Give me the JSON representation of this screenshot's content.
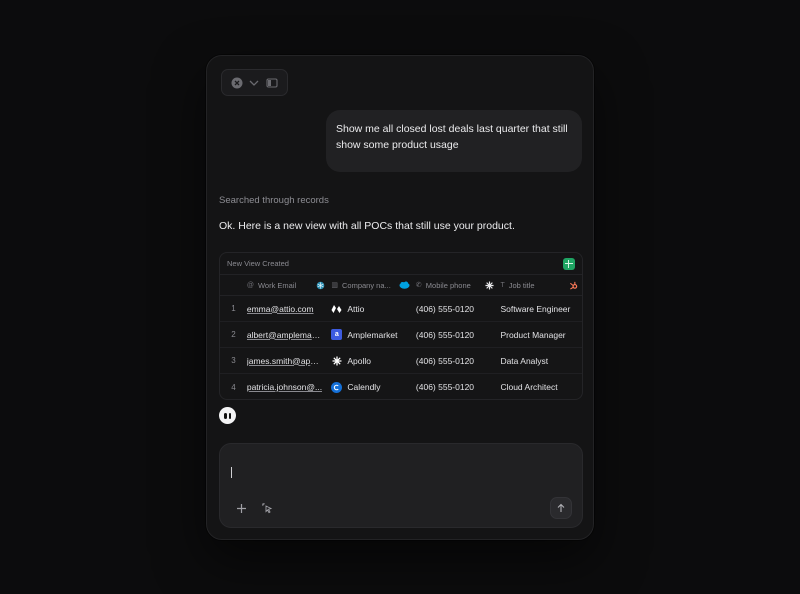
{
  "message": {
    "user": "Show me all closed lost deals last quarter that still show some product usage"
  },
  "status": "Searched through records",
  "reply": "Ok. Here is a new view with all POCs that still use your product.",
  "table": {
    "title": "New View Created",
    "columns": {
      "email": "Work Email",
      "company": "Company na...",
      "phone": "Mobile phone",
      "job": "Job title"
    },
    "rows": [
      {
        "num": "1",
        "email": "emma@attio.com",
        "company": "Attio",
        "phone": "(406) 555-0120",
        "job": "Software Engineer"
      },
      {
        "num": "2",
        "email": "albert@amplemark...",
        "company": "Amplemarket",
        "phone": "(406) 555-0120",
        "job": "Product Manager"
      },
      {
        "num": "3",
        "email": "james.smith@apoll...",
        "company": "Apollo",
        "phone": "(406) 555-0120",
        "job": "Data Analyst"
      },
      {
        "num": "4",
        "email": "patricia.johnson@...",
        "company": "Calendly",
        "phone": "(406) 555-0120",
        "job": "Cloud Architect"
      }
    ]
  },
  "colors": {
    "background": "#0c0c0d",
    "panel": "#141415",
    "bubble": "#212123",
    "accent_sheet": "#1fa463",
    "hubspot": "#ff7a59",
    "salesforce": "#00a1e0"
  }
}
